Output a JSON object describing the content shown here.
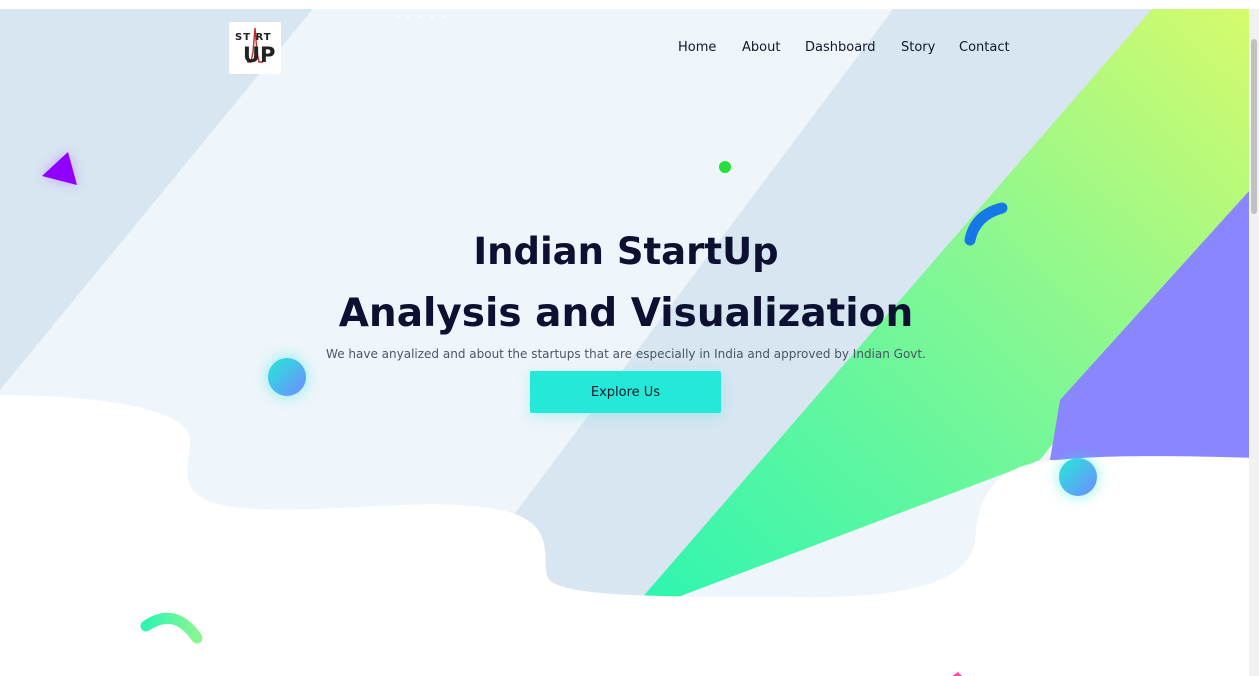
{
  "brand": {
    "logo_top": "ST RT",
    "logo_bottom": "UP"
  },
  "nav": {
    "items": [
      {
        "label": "Home"
      },
      {
        "label": "About"
      },
      {
        "label": "Dashboard"
      },
      {
        "label": "Story"
      },
      {
        "label": "Contact"
      }
    ]
  },
  "hero": {
    "title_line1": "Indian StartUp",
    "title_line2": "Analysis and Visualization",
    "subtitle": "We have anyalized and about the startups that are especially in India and approved by Indian Govt.",
    "cta_label": "Explore Us"
  },
  "colors": {
    "title": "#0c1131",
    "accent": "#25e9d8",
    "stripe_green": "#2ef5b0",
    "stripe_lime": "#d8fb6a",
    "stripe_purple": "#8a86ff"
  }
}
